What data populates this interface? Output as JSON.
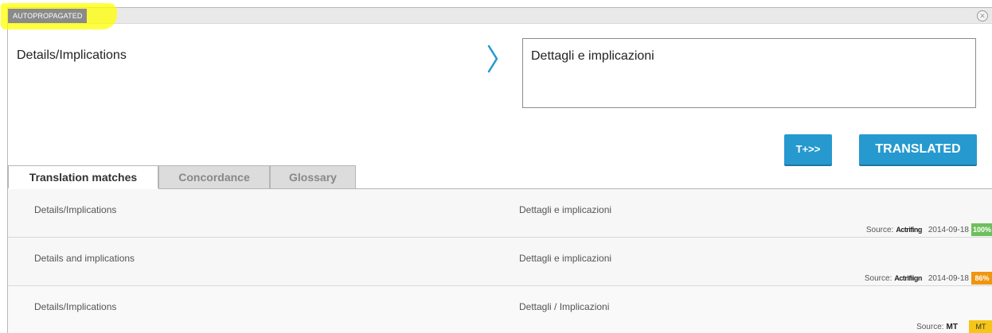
{
  "segment": {
    "status_tag": "AUTOPROPAGATED",
    "close_glyph": "✕",
    "source_text": "Details/Implications",
    "target_text": "Dettagli e implicazioni",
    "arrow_icon": "chevron-right-icon"
  },
  "buttons": {
    "tplus_label": "T+>>",
    "translated_label": "TRANSLATED"
  },
  "tabs": [
    {
      "label": "Translation matches",
      "active": true
    },
    {
      "label": "Concordance",
      "active": false
    },
    {
      "label": "Glossary",
      "active": false
    }
  ],
  "matches": [
    {
      "source": "Details/Implications",
      "target": "Dettagli e implicazioni",
      "source_label": "Source:",
      "author": "Actrifing",
      "date": "2014-09-18",
      "score": "100%",
      "score_color": "#6dbf5c"
    },
    {
      "source": "Details and implications",
      "target": "Dettagli e implicazioni",
      "source_label": "Source:",
      "author": "Actrifiign",
      "date": "2014-09-18",
      "score": "86%",
      "score_color": "#f0950e"
    },
    {
      "source": "Details/Implications",
      "target": "Dettagli / Implicazioni",
      "source_label": "Source:",
      "author": "MT",
      "date": "",
      "score": "MT",
      "score_color": "#f5c518"
    }
  ],
  "colors": {
    "accent": "#2699cf",
    "highlight": "#ffff00"
  }
}
